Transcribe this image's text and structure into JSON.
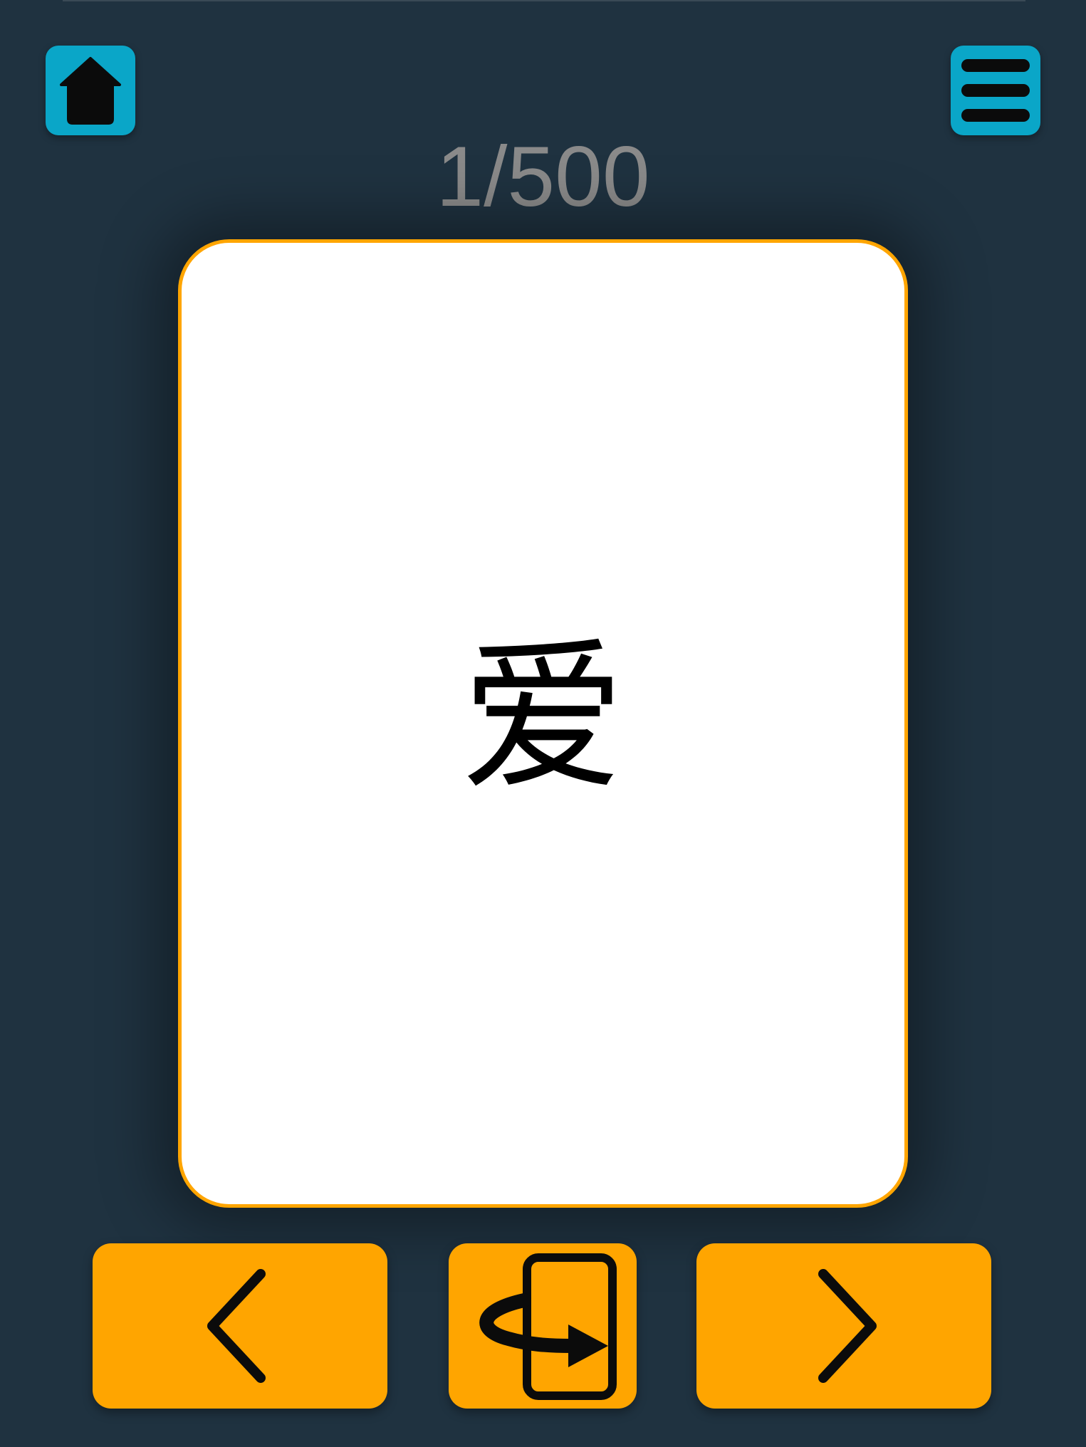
{
  "progress": {
    "current": 1,
    "total": 500,
    "label": "1/500"
  },
  "card": {
    "front_text": "爱"
  },
  "icons": {
    "home": "home-icon",
    "menu": "hamburger-menu-icon",
    "previous": "chevron-left-icon",
    "flip": "flip-card-icon",
    "next": "chevron-right-icon"
  },
  "colors": {
    "background": "#1f3240",
    "accent_blue": "#0aa6c8",
    "accent_orange": "#ffa500",
    "card_background": "#ffffff",
    "counter_text": "#8a8a8a"
  }
}
